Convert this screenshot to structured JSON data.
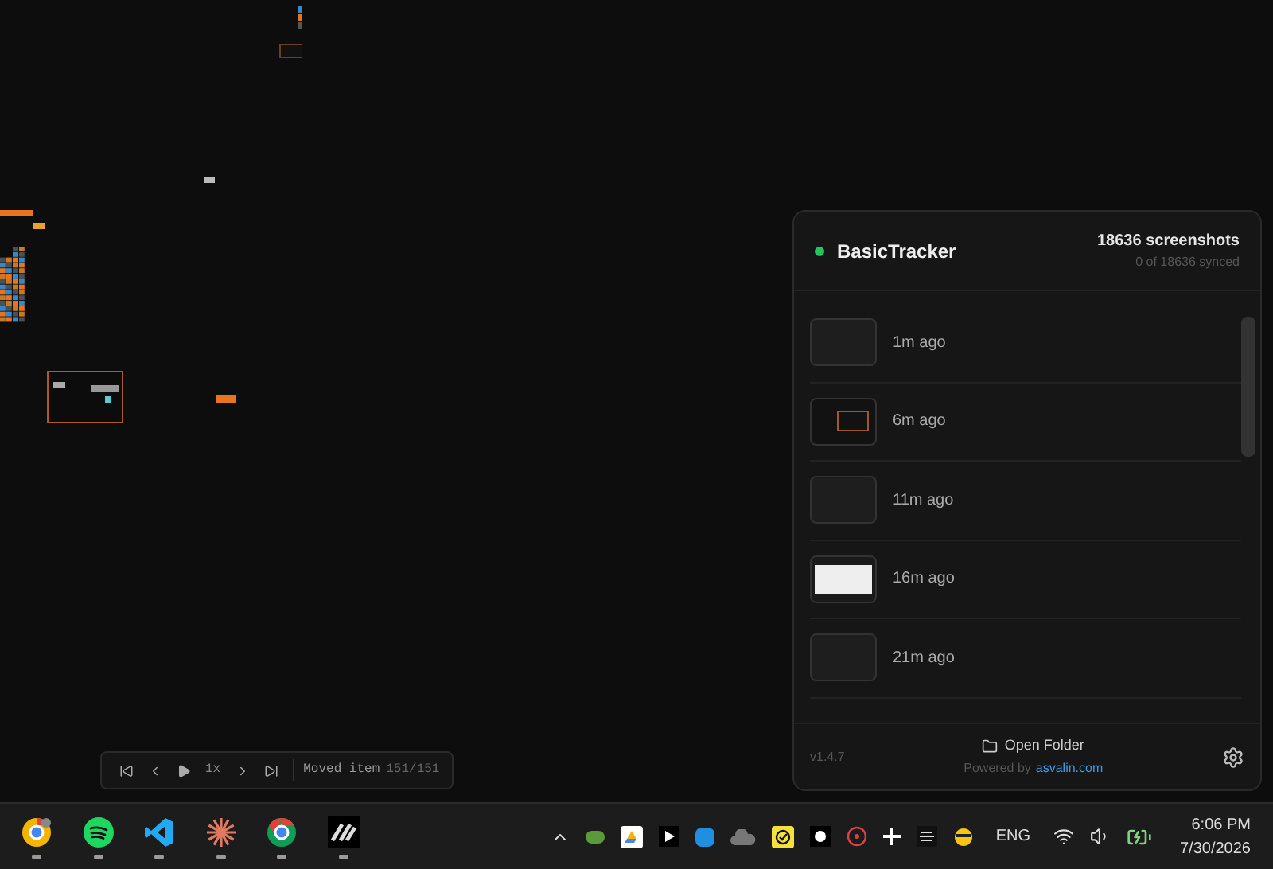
{
  "playback": {
    "speed": "1x",
    "status": "Moved item",
    "position": "151/151"
  },
  "panel": {
    "title": "BasicTracker",
    "connected": true,
    "count": "18636 screenshots",
    "synced": "0 of 18636 synced",
    "screenshots": [
      {
        "label": "1m ago",
        "kind": "dark"
      },
      {
        "label": "6m ago",
        "kind": "framed"
      },
      {
        "label": "11m ago",
        "kind": "dark"
      },
      {
        "label": "16m ago",
        "kind": "light"
      },
      {
        "label": "21m ago",
        "kind": "dark"
      }
    ],
    "version": "v1.4.7",
    "open_folder": "Open Folder",
    "powered_by": "Powered by",
    "link": "asvalin.com"
  },
  "taskbar": {
    "language": "ENG",
    "time": "6:06 PM",
    "date": "7/30/2026"
  }
}
